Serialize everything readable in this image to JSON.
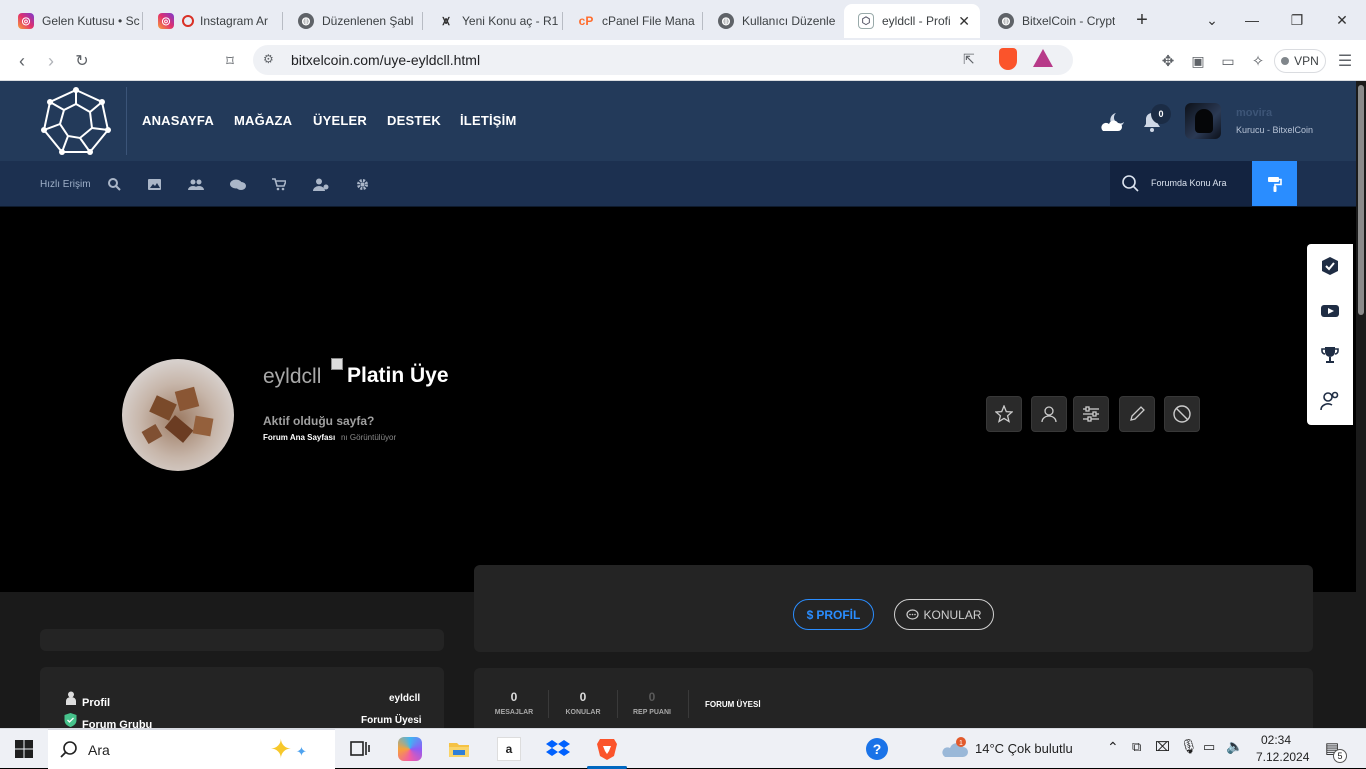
{
  "browser": {
    "tabs": [
      {
        "label": "Gelen Kutusu • Sc",
        "icon": "instagram-icon"
      },
      {
        "label": "Instagram Ar",
        "icon": "instagram-icon"
      },
      {
        "label": "Düzenlenen Şabl",
        "icon": "globe-icon"
      },
      {
        "label": "Yeni Konu aç - R1",
        "icon": "site-icon"
      },
      {
        "label": "cPanel File Mana",
        "icon": "cpanel-icon"
      },
      {
        "label": "Kullanıcı Düzenle",
        "icon": "globe-icon"
      },
      {
        "label": "eyldcll - Profi",
        "icon": "bitxel-icon",
        "active": true
      },
      {
        "label": "BitxelCoin - Crypt",
        "icon": "globe-icon"
      }
    ],
    "url": "bitxelcoin.com/uye-eyldcll.html",
    "vpn_label": "VPN"
  },
  "header": {
    "nav": [
      "ANASAYFA",
      "MAĞAZA",
      "ÜYELER",
      "DESTEK",
      "İLETİŞİM"
    ],
    "notification_count": "0",
    "user_name": "movira",
    "user_role": "Kurucu - BitxelCoin"
  },
  "subbar": {
    "quick_access": "Hızlı Erişim",
    "search_placeholder": "Forumda Konu Ara"
  },
  "profile": {
    "username": "eyldcll",
    "rank_image_alt": "Platin Üye",
    "active_page_title": "Aktif olduğu sayfa?",
    "active_page_link": "Forum Ana Sayfası",
    "active_page_suffix": "nı Görüntülüyor"
  },
  "tabs": {
    "profile": "PROFİL",
    "topics": "KONULAR"
  },
  "info": {
    "rows": [
      {
        "label": "Profil",
        "value": "eyldcll"
      },
      {
        "label": "Forum Grubu",
        "value": "Forum Üyesi"
      }
    ]
  },
  "stats": {
    "items": [
      {
        "value": "0",
        "label": "MESAJLAR"
      },
      {
        "value": "0",
        "label": "KONULAR"
      },
      {
        "value": "0",
        "label": "REP PUANI"
      }
    ],
    "group": "FORUM ÜYESİ"
  },
  "taskbar": {
    "search": "Ara",
    "weather": "14°C  Çok bulutlu",
    "time": "02:34",
    "date": "7.12.2024",
    "notif_count": "5"
  },
  "colors": {
    "header": "#233a5a",
    "subbar": "#1c3050",
    "accent": "#2a8dff"
  }
}
